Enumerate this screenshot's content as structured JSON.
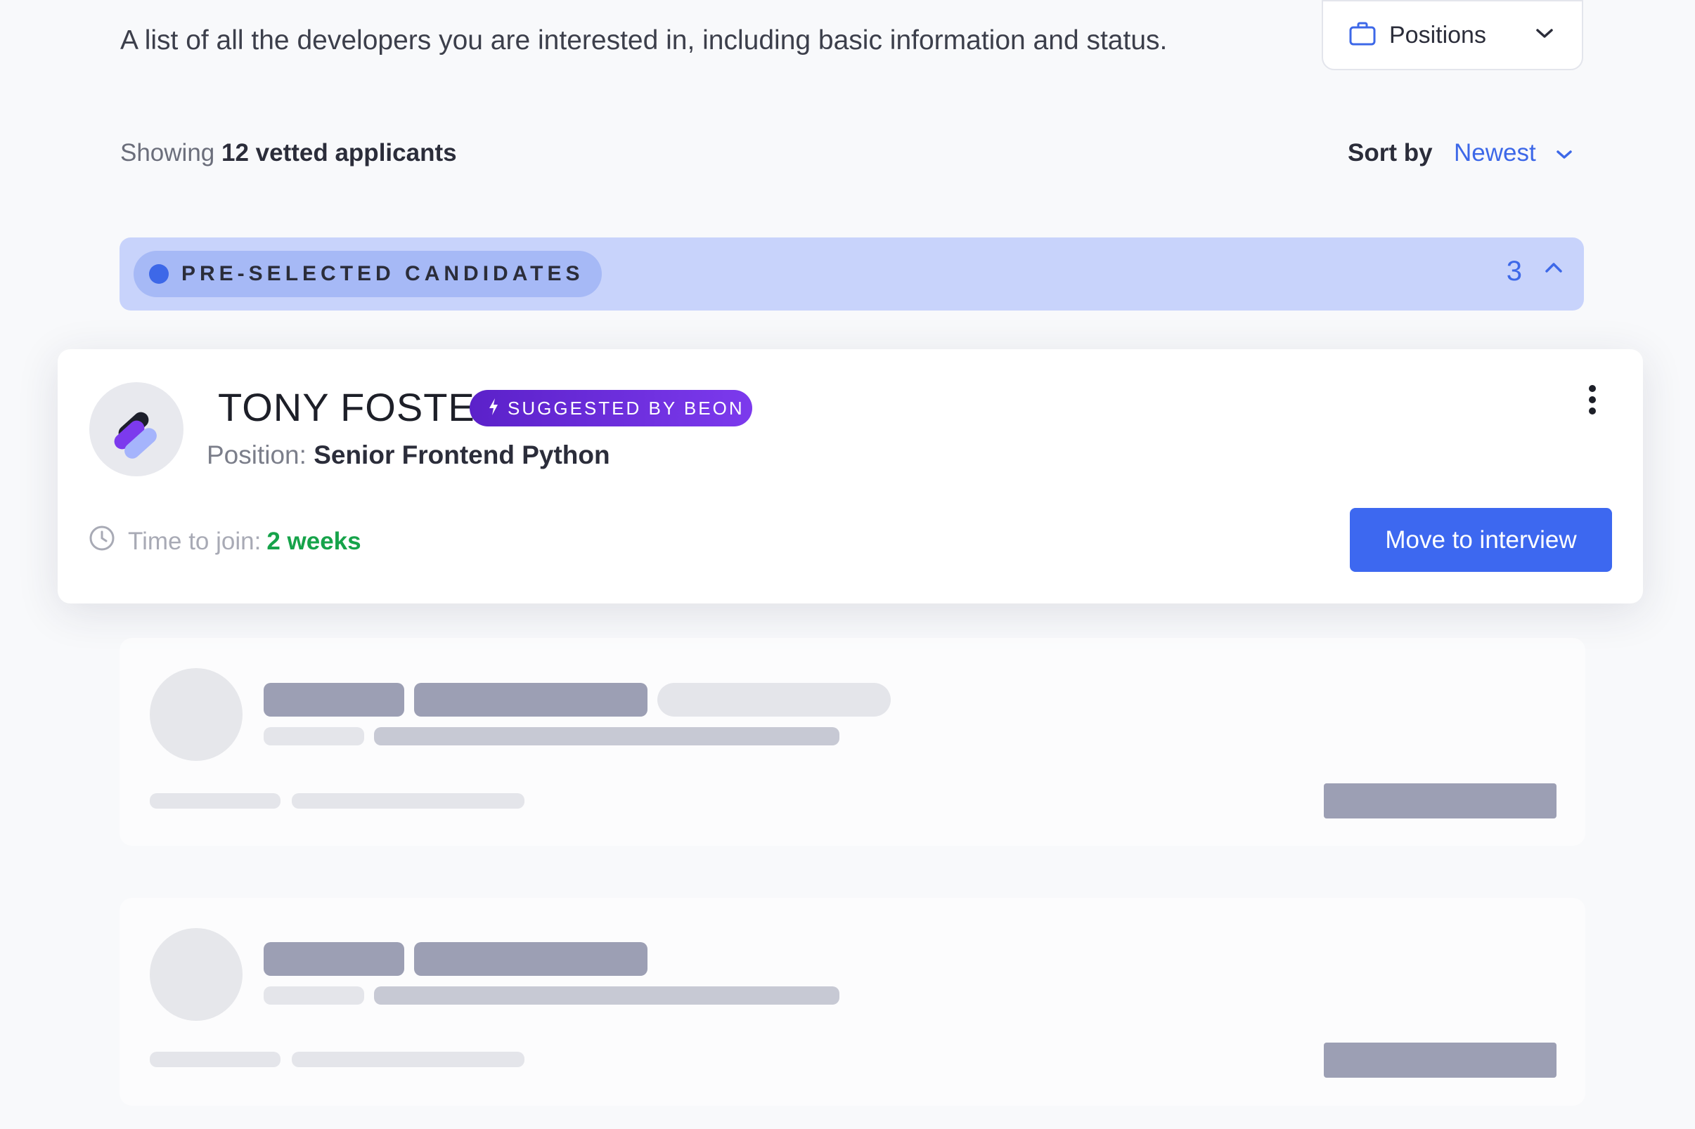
{
  "header": {
    "subtitle": "A list of all the developers you are interested in, including basic information and status.",
    "positions_label": "Positions"
  },
  "summary": {
    "showing_prefix": "Showing",
    "showing_count": "12 vetted applicants",
    "sort_label": "Sort by",
    "sort_value": "Newest"
  },
  "group": {
    "label": "PRE-SELECTED CANDIDATES",
    "count": "3"
  },
  "candidate": {
    "name": "TONY FOSTER",
    "badge": "SUGGESTED BY BEON",
    "position_label": "Position:",
    "position_value": "Senior Frontend Python",
    "join_label": "Time to join:",
    "join_value": "2 weeks",
    "action_label": "Move to interview"
  },
  "colors": {
    "accent": "#3d68e8",
    "badge_gradient_start": "#5b21c9",
    "badge_gradient_end": "#7c3aed",
    "success": "#16a34a",
    "group_bar": "#c8d3fb"
  },
  "icons": {
    "positions": "briefcase-icon",
    "dropdown": "chevron-down-icon",
    "collapse": "chevron-up-icon",
    "menu": "more-vertical-icon",
    "time": "clock-icon"
  }
}
